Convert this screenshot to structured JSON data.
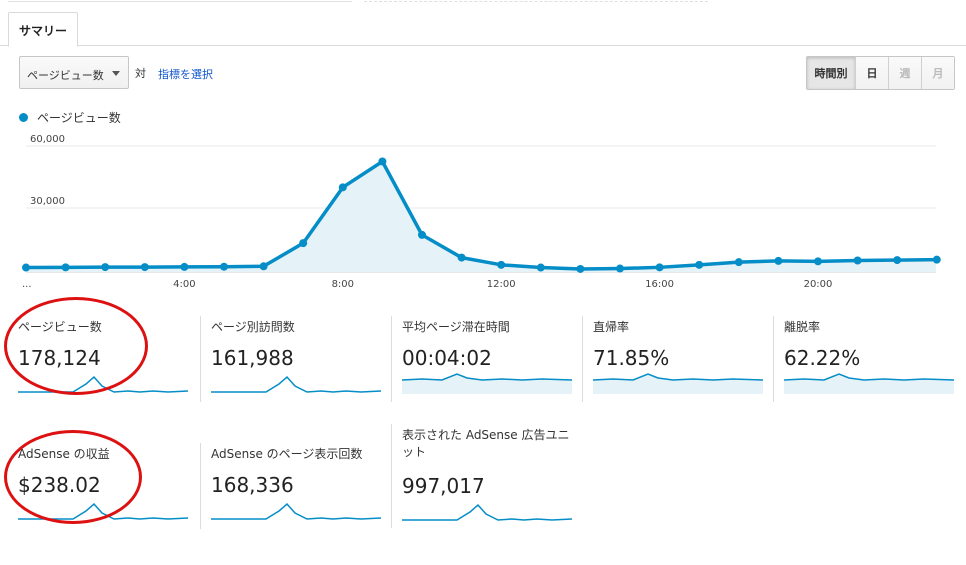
{
  "tabs": {
    "summary": "サマリー"
  },
  "controls": {
    "metric_select": "ページビュー数",
    "vs": "対",
    "select_metric_link": "指標を選択",
    "range": {
      "hourly": "時間別",
      "day": "日",
      "week": "週",
      "month": "月"
    }
  },
  "legend": {
    "series": "ページビュー数"
  },
  "colors": {
    "series": "#058dc7",
    "fill": "#e5f2f8",
    "annotation": "#dd1111"
  },
  "chart_data": {
    "type": "area",
    "y_ticks": [
      "60,000",
      "30,000"
    ],
    "x_ticks": [
      "...",
      "4:00",
      "8:00",
      "12:00",
      "16:00",
      "20:00"
    ],
    "x_tick_hours": [
      0,
      4,
      8,
      12,
      16,
      20
    ],
    "ylim": [
      0,
      60000
    ],
    "x": [
      0,
      1,
      2,
      3,
      4,
      5,
      6,
      7,
      8,
      9,
      10,
      11,
      12,
      13,
      14,
      15,
      16,
      17,
      18,
      19,
      20,
      21,
      22,
      23
    ],
    "series": [
      {
        "values": [
          1200,
          1300,
          1400,
          1400,
          1500,
          1600,
          1800,
          13000,
          40000,
          52500,
          17000,
          6000,
          2500,
          1200,
          500,
          700,
          1300,
          2500,
          3800,
          4400,
          4200,
          4600,
          4800,
          5000
        ]
      }
    ]
  },
  "metrics": [
    {
      "name": "ページビュー数",
      "value": "178,124",
      "spark": "peak"
    },
    {
      "name": "ページ別訪問数",
      "value": "161,988",
      "spark": "peak"
    },
    {
      "name": "平均ページ滞在時間",
      "value": "00:04:02",
      "spark": "flat"
    },
    {
      "name": "直帰率",
      "value": "71.85%",
      "spark": "flat"
    },
    {
      "name": "離脱率",
      "value": "62.22%",
      "spark": "flat"
    },
    {
      "name": "AdSense の収益",
      "value": "$238.02",
      "spark": "peak"
    },
    {
      "name": "AdSense のページ表示回数",
      "value": "168,336",
      "spark": "peak"
    },
    {
      "name": "表示された AdSense 広告ユニット",
      "value": "997,017",
      "spark": "peak"
    }
  ]
}
